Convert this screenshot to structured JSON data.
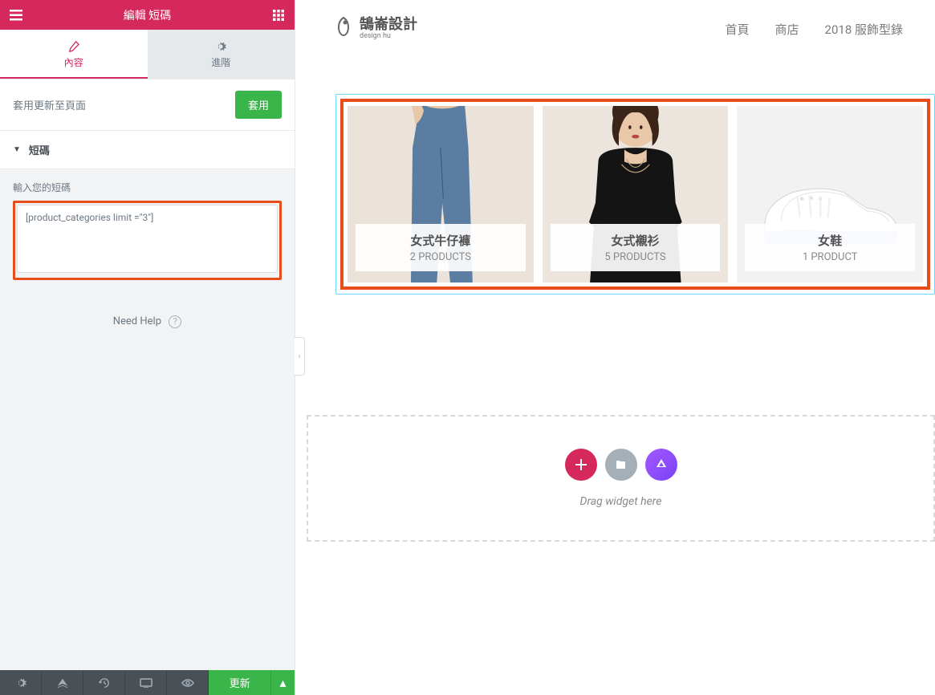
{
  "sidebar": {
    "title": "編輯 短碼",
    "tabs": {
      "content": "內容",
      "advanced": "進階"
    },
    "apply_label": "套用更新至頁面",
    "apply_button": "套用",
    "section_title": "短碼",
    "field_label": "輸入您的短碼",
    "shortcode_value": "[product_categories limit =\"3\"]",
    "need_help": "Need Help",
    "update_button": "更新"
  },
  "site": {
    "logo_text": "鵠崙設計",
    "logo_sub": "design hu",
    "nav": {
      "home": "首頁",
      "shop": "商店",
      "catalog": "2018 服飾型錄"
    }
  },
  "products": [
    {
      "title": "女式牛仔褲",
      "count": "2 PRODUCTS"
    },
    {
      "title": "女式襯衫",
      "count": "5 PRODUCTS"
    },
    {
      "title": "女鞋",
      "count": "1 PRODUCT"
    }
  ],
  "drag_text": "Drag widget here"
}
